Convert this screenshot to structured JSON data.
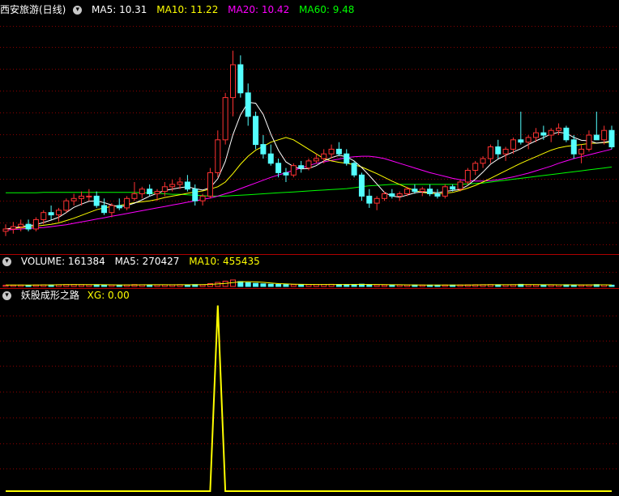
{
  "colors": {
    "up": "#ff3232",
    "down": "#54ffff",
    "ma5": "#ffffff",
    "ma10": "#ffff00",
    "ma20": "#ff00ff",
    "ma60": "#00ff00",
    "grid": "#8b0000",
    "xg": "#ffff00"
  },
  "price_panel": {
    "title": "西安旅游(日线)",
    "ma5": "MA5: 10.31",
    "ma10": "MA10: 11.22",
    "ma20": "MA20: 10.42",
    "ma60": "MA60: 9.48"
  },
  "volume_panel": {
    "volume": "VOLUME: 161384",
    "ma5": "MA5: 270427",
    "ma10": "MA10: 455435"
  },
  "indicator_panel": {
    "name": "妖股成形之路",
    "xg": "XG: 0.00"
  },
  "chart_data": [
    {
      "type": "candlestick",
      "ohlc": [
        [
          9.05,
          9.2,
          8.95,
          9.1
        ],
        [
          9.1,
          9.25,
          9.0,
          9.15
        ],
        [
          9.15,
          9.3,
          9.05,
          9.2
        ],
        [
          9.2,
          9.3,
          9.05,
          9.1
        ],
        [
          9.1,
          9.35,
          9.05,
          9.3
        ],
        [
          9.3,
          9.5,
          9.2,
          9.45
        ],
        [
          9.45,
          9.6,
          9.3,
          9.4
        ],
        [
          9.4,
          9.55,
          9.25,
          9.5
        ],
        [
          9.5,
          9.75,
          9.45,
          9.7
        ],
        [
          9.7,
          9.85,
          9.6,
          9.75
        ],
        [
          9.75,
          9.9,
          9.6,
          9.8
        ],
        [
          9.8,
          9.95,
          9.7,
          9.8
        ],
        [
          9.8,
          9.9,
          9.55,
          9.6
        ],
        [
          9.6,
          9.75,
          9.4,
          9.45
        ],
        [
          9.45,
          9.65,
          9.35,
          9.6
        ],
        [
          9.6,
          9.75,
          9.5,
          9.55
        ],
        [
          9.55,
          9.8,
          9.5,
          9.75
        ],
        [
          9.75,
          10.1,
          9.7,
          9.85
        ],
        [
          9.85,
          10.0,
          9.75,
          9.95
        ],
        [
          9.95,
          10.05,
          9.8,
          9.85
        ],
        [
          9.85,
          9.95,
          9.7,
          9.9
        ],
        [
          9.9,
          10.1,
          9.8,
          10.0
        ],
        [
          10.0,
          10.15,
          9.9,
          10.05
        ],
        [
          10.05,
          10.2,
          9.95,
          10.1
        ],
        [
          10.1,
          10.25,
          9.9,
          9.95
        ],
        [
          9.95,
          10.05,
          9.6,
          9.7
        ],
        [
          9.7,
          9.85,
          9.6,
          9.8
        ],
        [
          9.8,
          10.4,
          9.75,
          10.3
        ],
        [
          10.3,
          11.2,
          10.2,
          11.0
        ],
        [
          11.0,
          12.0,
          10.9,
          11.9
        ],
        [
          11.9,
          12.9,
          11.5,
          12.6
        ],
        [
          12.6,
          12.8,
          11.9,
          12.0
        ],
        [
          12.0,
          12.2,
          11.3,
          11.5
        ],
        [
          11.5,
          11.6,
          10.8,
          10.9
        ],
        [
          10.9,
          11.1,
          10.6,
          10.7
        ],
        [
          10.7,
          10.9,
          10.45,
          10.5
        ],
        [
          10.5,
          10.6,
          10.2,
          10.3
        ],
        [
          10.3,
          10.4,
          10.1,
          10.25
        ],
        [
          10.25,
          10.5,
          10.2,
          10.45
        ],
        [
          10.45,
          10.55,
          10.3,
          10.4
        ],
        [
          10.4,
          10.6,
          10.35,
          10.55
        ],
        [
          10.55,
          10.7,
          10.5,
          10.6
        ],
        [
          10.6,
          10.8,
          10.5,
          10.7
        ],
        [
          10.7,
          10.9,
          10.6,
          10.8
        ],
        [
          10.8,
          10.95,
          10.65,
          10.7
        ],
        [
          10.7,
          10.8,
          10.45,
          10.5
        ],
        [
          10.5,
          10.55,
          10.2,
          10.25
        ],
        [
          10.25,
          10.3,
          9.7,
          9.8
        ],
        [
          9.8,
          9.95,
          9.55,
          9.65
        ],
        [
          9.65,
          9.8,
          9.5,
          9.75
        ],
        [
          9.75,
          9.9,
          9.7,
          9.85
        ],
        [
          9.85,
          9.95,
          9.75,
          9.8
        ],
        [
          9.8,
          9.9,
          9.7,
          9.85
        ],
        [
          9.85,
          10.0,
          9.8,
          9.95
        ],
        [
          9.95,
          10.05,
          9.85,
          9.9
        ],
        [
          9.9,
          10.0,
          9.8,
          9.95
        ],
        [
          9.95,
          10.05,
          9.8,
          9.85
        ],
        [
          9.85,
          9.95,
          9.75,
          9.8
        ],
        [
          9.8,
          10.05,
          9.75,
          10.0
        ],
        [
          10.0,
          10.05,
          9.9,
          9.95
        ],
        [
          9.95,
          10.15,
          9.9,
          10.1
        ],
        [
          10.1,
          10.4,
          10.05,
          10.35
        ],
        [
          10.35,
          10.55,
          10.25,
          10.5
        ],
        [
          10.5,
          10.65,
          10.4,
          10.6
        ],
        [
          10.6,
          10.9,
          10.5,
          10.85
        ],
        [
          10.85,
          11.0,
          10.6,
          10.7
        ],
        [
          10.7,
          10.85,
          10.55,
          10.8
        ],
        [
          10.8,
          11.05,
          10.7,
          11.0
        ],
        [
          11.0,
          11.6,
          10.9,
          10.95
        ],
        [
          10.95,
          11.1,
          10.8,
          11.05
        ],
        [
          11.05,
          11.25,
          10.95,
          11.15
        ],
        [
          11.15,
          11.3,
          11.0,
          11.1
        ],
        [
          11.1,
          11.25,
          10.95,
          11.2
        ],
        [
          11.2,
          11.35,
          11.1,
          11.25
        ],
        [
          11.25,
          11.3,
          10.95,
          11.0
        ],
        [
          11.0,
          11.1,
          10.6,
          10.7
        ],
        [
          10.7,
          10.9,
          10.5,
          10.8
        ],
        [
          10.8,
          11.2,
          10.75,
          11.1
        ],
        [
          11.1,
          11.6,
          11.0,
          11.0
        ],
        [
          11.0,
          11.3,
          10.9,
          11.2
        ],
        [
          11.2,
          11.3,
          10.8,
          10.85
        ]
      ],
      "ma": {
        "ma5": [
          9.1,
          9.12,
          9.15,
          9.17,
          9.19,
          9.24,
          9.29,
          9.35,
          9.45,
          9.56,
          9.63,
          9.69,
          9.7,
          9.66,
          9.61,
          9.57,
          9.6,
          9.65,
          9.72,
          9.8,
          9.86,
          9.92,
          9.95,
          9.98,
          10.0,
          9.96,
          9.93,
          9.98,
          10.17,
          10.54,
          11.11,
          11.53,
          11.8,
          11.78,
          11.54,
          11.12,
          10.78,
          10.53,
          10.43,
          10.38,
          10.39,
          10.45,
          10.55,
          10.62,
          10.67,
          10.64,
          10.55,
          10.41,
          10.24,
          10.06,
          9.88,
          9.8,
          9.78,
          9.82,
          9.87,
          9.89,
          9.89,
          9.87,
          9.9,
          9.92,
          9.94,
          10.03,
          10.16,
          10.31,
          10.48,
          10.59,
          10.67,
          10.74,
          10.81,
          10.9,
          10.98,
          11.05,
          11.12,
          11.16,
          11.14,
          11.05,
          10.99,
          10.98,
          10.93,
          10.95,
          10.98
        ],
        "ma10": [
          9.1,
          9.11,
          9.13,
          9.14,
          9.16,
          9.18,
          9.2,
          9.23,
          9.28,
          9.33,
          9.39,
          9.45,
          9.51,
          9.55,
          9.58,
          9.6,
          9.63,
          9.66,
          9.68,
          9.7,
          9.73,
          9.77,
          9.8,
          9.83,
          9.86,
          9.89,
          9.91,
          9.95,
          10.0,
          10.1,
          10.28,
          10.48,
          10.65,
          10.78,
          10.86,
          10.95,
          11.0,
          11.05,
          11.0,
          10.9,
          10.8,
          10.7,
          10.6,
          10.55,
          10.52,
          10.5,
          10.47,
          10.42,
          10.35,
          10.28,
          10.2,
          10.12,
          10.05,
          9.98,
          9.92,
          9.88,
          9.86,
          9.85,
          9.86,
          9.88,
          9.92,
          9.97,
          10.03,
          10.1,
          10.18,
          10.26,
          10.34,
          10.42,
          10.5,
          10.57,
          10.64,
          10.71,
          10.78,
          10.83,
          10.86,
          10.88,
          10.9,
          10.92,
          10.93,
          10.94,
          10.95
        ],
        "ma20": [
          9.08,
          9.09,
          9.1,
          9.11,
          9.12,
          9.13,
          9.15,
          9.17,
          9.19,
          9.22,
          9.25,
          9.28,
          9.31,
          9.34,
          9.37,
          9.4,
          9.43,
          9.46,
          9.49,
          9.52,
          9.55,
          9.58,
          9.61,
          9.64,
          9.67,
          9.7,
          9.73,
          9.76,
          9.8,
          9.85,
          9.9,
          9.96,
          10.02,
          10.08,
          10.14,
          10.2,
          10.25,
          10.3,
          10.35,
          10.4,
          10.45,
          10.5,
          10.53,
          10.56,
          10.59,
          10.62,
          10.64,
          10.65,
          10.65,
          10.63,
          10.6,
          10.55,
          10.5,
          10.45,
          10.4,
          10.35,
          10.3,
          10.26,
          10.22,
          10.18,
          10.15,
          10.13,
          10.12,
          10.12,
          10.13,
          10.15,
          10.18,
          10.21,
          10.25,
          10.29,
          10.34,
          10.39,
          10.44,
          10.5,
          10.55,
          10.6,
          10.64,
          10.68,
          10.72,
          10.76,
          10.8
        ],
        "ma60": [
          9.87,
          9.87,
          9.87,
          9.87,
          9.87,
          9.88,
          9.88,
          9.88,
          9.88,
          9.88,
          9.88,
          9.88,
          9.88,
          9.88,
          9.88,
          9.88,
          9.88,
          9.88,
          9.87,
          9.87,
          9.86,
          9.85,
          9.84,
          9.84,
          9.83,
          9.82,
          9.81,
          9.8,
          9.8,
          9.8,
          9.81,
          9.82,
          9.83,
          9.84,
          9.85,
          9.86,
          9.87,
          9.88,
          9.89,
          9.9,
          9.91,
          9.92,
          9.93,
          9.94,
          9.95,
          9.96,
          9.98,
          10.0,
          10.02,
          10.03,
          10.04,
          10.05,
          10.05,
          10.05,
          10.05,
          10.05,
          10.05,
          10.05,
          10.05,
          10.05,
          10.05,
          10.06,
          10.07,
          10.08,
          10.1,
          10.12,
          10.14,
          10.16,
          10.18,
          10.2,
          10.22,
          10.24,
          10.26,
          10.28,
          10.3,
          10.32,
          10.34,
          10.36,
          10.38,
          10.4,
          10.42
        ]
      },
      "ylim": [
        8.6,
        13.6
      ]
    },
    {
      "type": "bar",
      "values": [
        150000,
        160000,
        170000,
        150000,
        180000,
        200000,
        190000,
        210000,
        230000,
        240000,
        220000,
        200000,
        210000,
        190000,
        180000,
        170000,
        190000,
        230000,
        210000,
        200000,
        190000,
        200000,
        210000,
        220000,
        200000,
        230000,
        210000,
        350000,
        500000,
        650000,
        800000,
        600000,
        450000,
        380000,
        320000,
        280000,
        250000,
        240000,
        230000,
        220000,
        230000,
        240000,
        250000,
        260000,
        240000,
        230000,
        240000,
        280000,
        220000,
        200000,
        190000,
        180000,
        185000,
        190000,
        180000,
        175000,
        170000,
        165000,
        175000,
        170000,
        185000,
        200000,
        210000,
        220000,
        230000,
        210000,
        200000,
        220000,
        260000,
        210000,
        200000,
        195000,
        190000,
        200000,
        210000,
        190000,
        180000,
        200000,
        230000,
        200000,
        161384
      ],
      "ma5": [
        170000,
        168000,
        166000,
        172000,
        180000,
        188000,
        195000,
        205000,
        218000,
        228000,
        228000,
        222000,
        220000,
        214000,
        204000,
        194000,
        188000,
        192000,
        200000,
        206000,
        208000,
        206000,
        204000,
        208000,
        212000,
        214000,
        220000,
        250000,
        305000,
        380000,
        480000,
        570000,
        590000,
        560000,
        510000,
        420000,
        350000,
        310000,
        280000,
        260000,
        250000,
        240000,
        238000,
        240000,
        242000,
        240000,
        238000,
        250000,
        245000,
        235000,
        225000,
        215000,
        205000,
        195000,
        190000,
        182000,
        178000,
        175000,
        172000,
        172000,
        175000,
        180000,
        188000,
        197000,
        207000,
        210000,
        212000,
        215000,
        225000,
        225000,
        220000,
        212000,
        205000,
        200000,
        199000,
        198000,
        193000,
        195000,
        200000,
        203000,
        195000
      ],
      "ylim": [
        0,
        2200000
      ]
    },
    {
      "type": "line",
      "values": [
        0,
        0,
        0,
        0,
        0,
        0,
        0,
        0,
        0,
        0,
        0,
        0,
        0,
        0,
        0,
        0,
        0,
        0,
        0,
        0,
        0,
        0,
        0,
        0,
        0,
        0,
        0,
        0,
        1,
        0,
        0,
        0,
        0,
        0,
        0,
        0,
        0,
        0,
        0,
        0,
        0,
        0,
        0,
        0,
        0,
        0,
        0,
        0,
        0,
        0,
        0,
        0,
        0,
        0,
        0,
        0,
        0,
        0,
        0,
        0,
        0,
        0,
        0,
        0,
        0,
        0,
        0,
        0,
        0,
        0,
        0,
        0,
        0,
        0,
        0,
        0,
        0,
        0,
        0,
        0,
        0
      ],
      "ylim": [
        0,
        1.02
      ]
    }
  ]
}
